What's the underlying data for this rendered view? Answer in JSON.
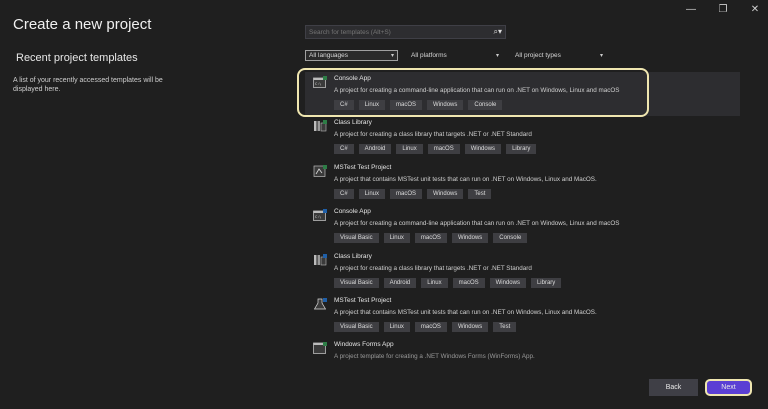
{
  "window": {
    "minimize": "—",
    "restore": "❐",
    "close": "✕"
  },
  "title": "Create a new project",
  "recent": {
    "heading": "Recent project templates",
    "description": "A list of your recently accessed templates will be displayed here."
  },
  "search": {
    "placeholder": "Search for templates (Alt+S)",
    "icon": "search-icon"
  },
  "filters": [
    {
      "label": "All languages",
      "selected": true
    },
    {
      "label": "All platforms",
      "selected": false
    },
    {
      "label": "All project types",
      "selected": false
    }
  ],
  "templates": [
    {
      "name": "Console App",
      "description": "A project for creating a command-line application that can run on .NET on Windows, Linux and macOS",
      "tags": [
        "C#",
        "Linux",
        "macOS",
        "Windows",
        "Console"
      ],
      "icon": "console-app-icon",
      "selected": true
    },
    {
      "name": "Class Library",
      "description": "A project for creating a class library that targets .NET or .NET Standard",
      "tags": [
        "C#",
        "Android",
        "Linux",
        "macOS",
        "Windows",
        "Library"
      ],
      "icon": "class-library-icon"
    },
    {
      "name": "MSTest Test Project",
      "description": "A project that contains MSTest unit tests that can run on .NET on Windows, Linux and MacOS.",
      "tags": [
        "C#",
        "Linux",
        "macOS",
        "Windows",
        "Test"
      ],
      "icon": "test-project-icon"
    },
    {
      "name": "Console App",
      "description": "A project for creating a command-line application that can run on .NET on Windows, Linux and macOS",
      "tags": [
        "Visual Basic",
        "Linux",
        "macOS",
        "Windows",
        "Console"
      ],
      "icon": "console-app-icon"
    },
    {
      "name": "Class Library",
      "description": "A project for creating a class library that targets .NET or .NET Standard",
      "tags": [
        "Visual Basic",
        "Android",
        "Linux",
        "macOS",
        "Windows",
        "Library"
      ],
      "icon": "class-library-icon"
    },
    {
      "name": "MSTest Test Project",
      "description": "A project that contains MSTest unit tests that can run on .NET on Windows, Linux and MacOS.",
      "tags": [
        "Visual Basic",
        "Linux",
        "macOS",
        "Windows",
        "Test"
      ],
      "icon": "test-project-icon"
    },
    {
      "name": "Windows Forms App",
      "description": "A project template for creating a .NET Windows Forms (WinForms) App.",
      "tags": [],
      "icon": "windows-forms-icon"
    }
  ],
  "buttons": {
    "back": "Back",
    "next": "Next"
  }
}
